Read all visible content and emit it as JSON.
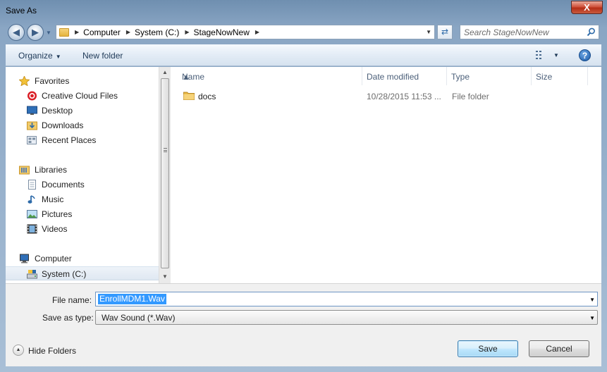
{
  "window": {
    "title": "Save As",
    "close_glyph": "X"
  },
  "nav": {
    "back_icon": "back-arrow-icon",
    "forward_icon": "forward-arrow-icon"
  },
  "address": {
    "crumbs": [
      "Computer",
      "System (C:)",
      "StageNowNew"
    ]
  },
  "search": {
    "placeholder": "Search StageNowNew"
  },
  "toolbar": {
    "organize_label": "Organize",
    "new_folder_label": "New folder",
    "help_glyph": "?"
  },
  "navigation_pane": {
    "favorites": {
      "label": "Favorites",
      "items": [
        "Creative Cloud Files",
        "Desktop",
        "Downloads",
        "Recent Places"
      ]
    },
    "libraries": {
      "label": "Libraries",
      "items": [
        "Documents",
        "Music",
        "Pictures",
        "Videos"
      ]
    },
    "computer": {
      "label": "Computer",
      "items": [
        "System (C:)"
      ],
      "selected": "System (C:)"
    }
  },
  "file_list": {
    "columns": [
      "Name",
      "Date modified",
      "Type",
      "Size"
    ],
    "rows": [
      {
        "name": "docs",
        "date_modified": "10/28/2015 11:53 ...",
        "type": "File folder",
        "size": ""
      }
    ]
  },
  "form": {
    "file_name_label": "File name:",
    "file_name_value": "EnrollMDM1.Wav",
    "save_type_label": "Save as type:",
    "save_type_value": "Wav Sound (*.Wav)"
  },
  "footer": {
    "hide_folders_label": "Hide Folders",
    "save_label": "Save",
    "cancel_label": "Cancel"
  },
  "colors": {
    "selection": "#3399ff",
    "frame": "#8aa6c4",
    "close_button": "#c8442b",
    "default_button_border": "#3c7fb1"
  }
}
